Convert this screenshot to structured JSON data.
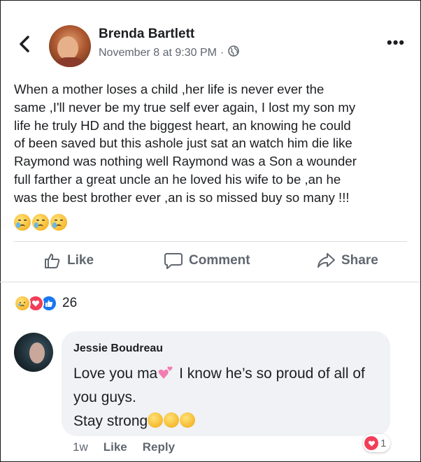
{
  "post": {
    "author": "Brenda Bartlett",
    "timestamp": "November 8 at 9:30 PM",
    "separator": "·",
    "privacy_icon": "globe-icon",
    "text": "When a mother  loses  a child ,her life is never ever the\nsame ,I'll never be my true self ever again, I lost my son my\nlife he truly HD and the biggest heart, an knowing he could\nof been saved  but this ashole just sat an watch him die like\nRaymond was nothing well Raymond  was a Son a wounder\nfull farther a great uncle an he loved his wife to be ,an he\nwas the best  brother ever ,an is so missed buy so many !!!",
    "trailing_emojis": [
      "sad-tear-emoji",
      "sad-tear-emoji",
      "sad-tear-emoji"
    ]
  },
  "nav": {
    "back_icon": "chevron-left-icon",
    "more_label": "•••"
  },
  "actions": {
    "like": "Like",
    "comment": "Comment",
    "share": "Share"
  },
  "reactions": {
    "types": [
      "sad",
      "love",
      "like"
    ],
    "count": "26"
  },
  "comment": {
    "author": "Jessie Boudreau",
    "line1_before": "Love you ma",
    "line1_after": " I know he’s so proud of all of you guys.",
    "line2": "Stay strong",
    "time": "1w",
    "like": "Like",
    "reply": "Reply",
    "reaction_count": "1"
  },
  "colors": {
    "text": "#1c1e21",
    "secondary": "#606770",
    "like_blue": "#1877f2",
    "love_red": "#f33e58",
    "bubble": "#f0f2f5"
  }
}
